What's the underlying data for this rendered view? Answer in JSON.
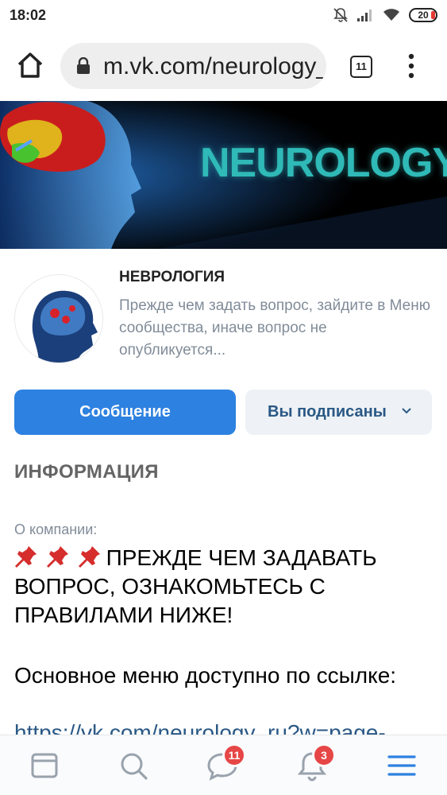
{
  "status_bar": {
    "time": "18:02",
    "battery": "20",
    "icons": [
      "mute-bell-icon",
      "signal-icon",
      "wifi-icon",
      "battery-icon"
    ]
  },
  "browser": {
    "url": "m.vk.com/neurology_ru",
    "tab_count": "11"
  },
  "cover": {
    "title": "NEUROLOGY"
  },
  "group": {
    "name": "НЕВРОЛОГИЯ",
    "status": "Прежде чем задать вопрос, зайдите в Меню сообщества, иначе вопрос не опубликуется..."
  },
  "actions": {
    "message": "Сообщение",
    "subscribed": "Вы подписаны"
  },
  "info": {
    "heading": "ИНФОРМАЦИЯ",
    "about_label": "О компании:",
    "about_text": "ПРЕЖДЕ ЧЕМ ЗАДАВАТЬ ВОПРОС, ОЗНАКОМЬТЕСЬ С ПРАВИЛАМИ НИЖЕ!",
    "menu_text": "Основное меню доступно по ссылке:",
    "menu_link": "https://vk.com/neurology_ru?w=page-"
  },
  "bottom_nav": {
    "items": [
      {
        "icon": "feed-icon"
      },
      {
        "icon": "search-icon"
      },
      {
        "icon": "messages-icon",
        "badge": "11"
      },
      {
        "icon": "notifications-icon",
        "badge": "3"
      },
      {
        "icon": "menu-icon"
      }
    ],
    "accent": "#2d81e0"
  },
  "colors": {
    "primary_button": "#2d81e0",
    "secondary_button": "#eef2f6",
    "link": "#2a5885",
    "badge": "#e64646",
    "cover_text": "#2fb9b7"
  }
}
